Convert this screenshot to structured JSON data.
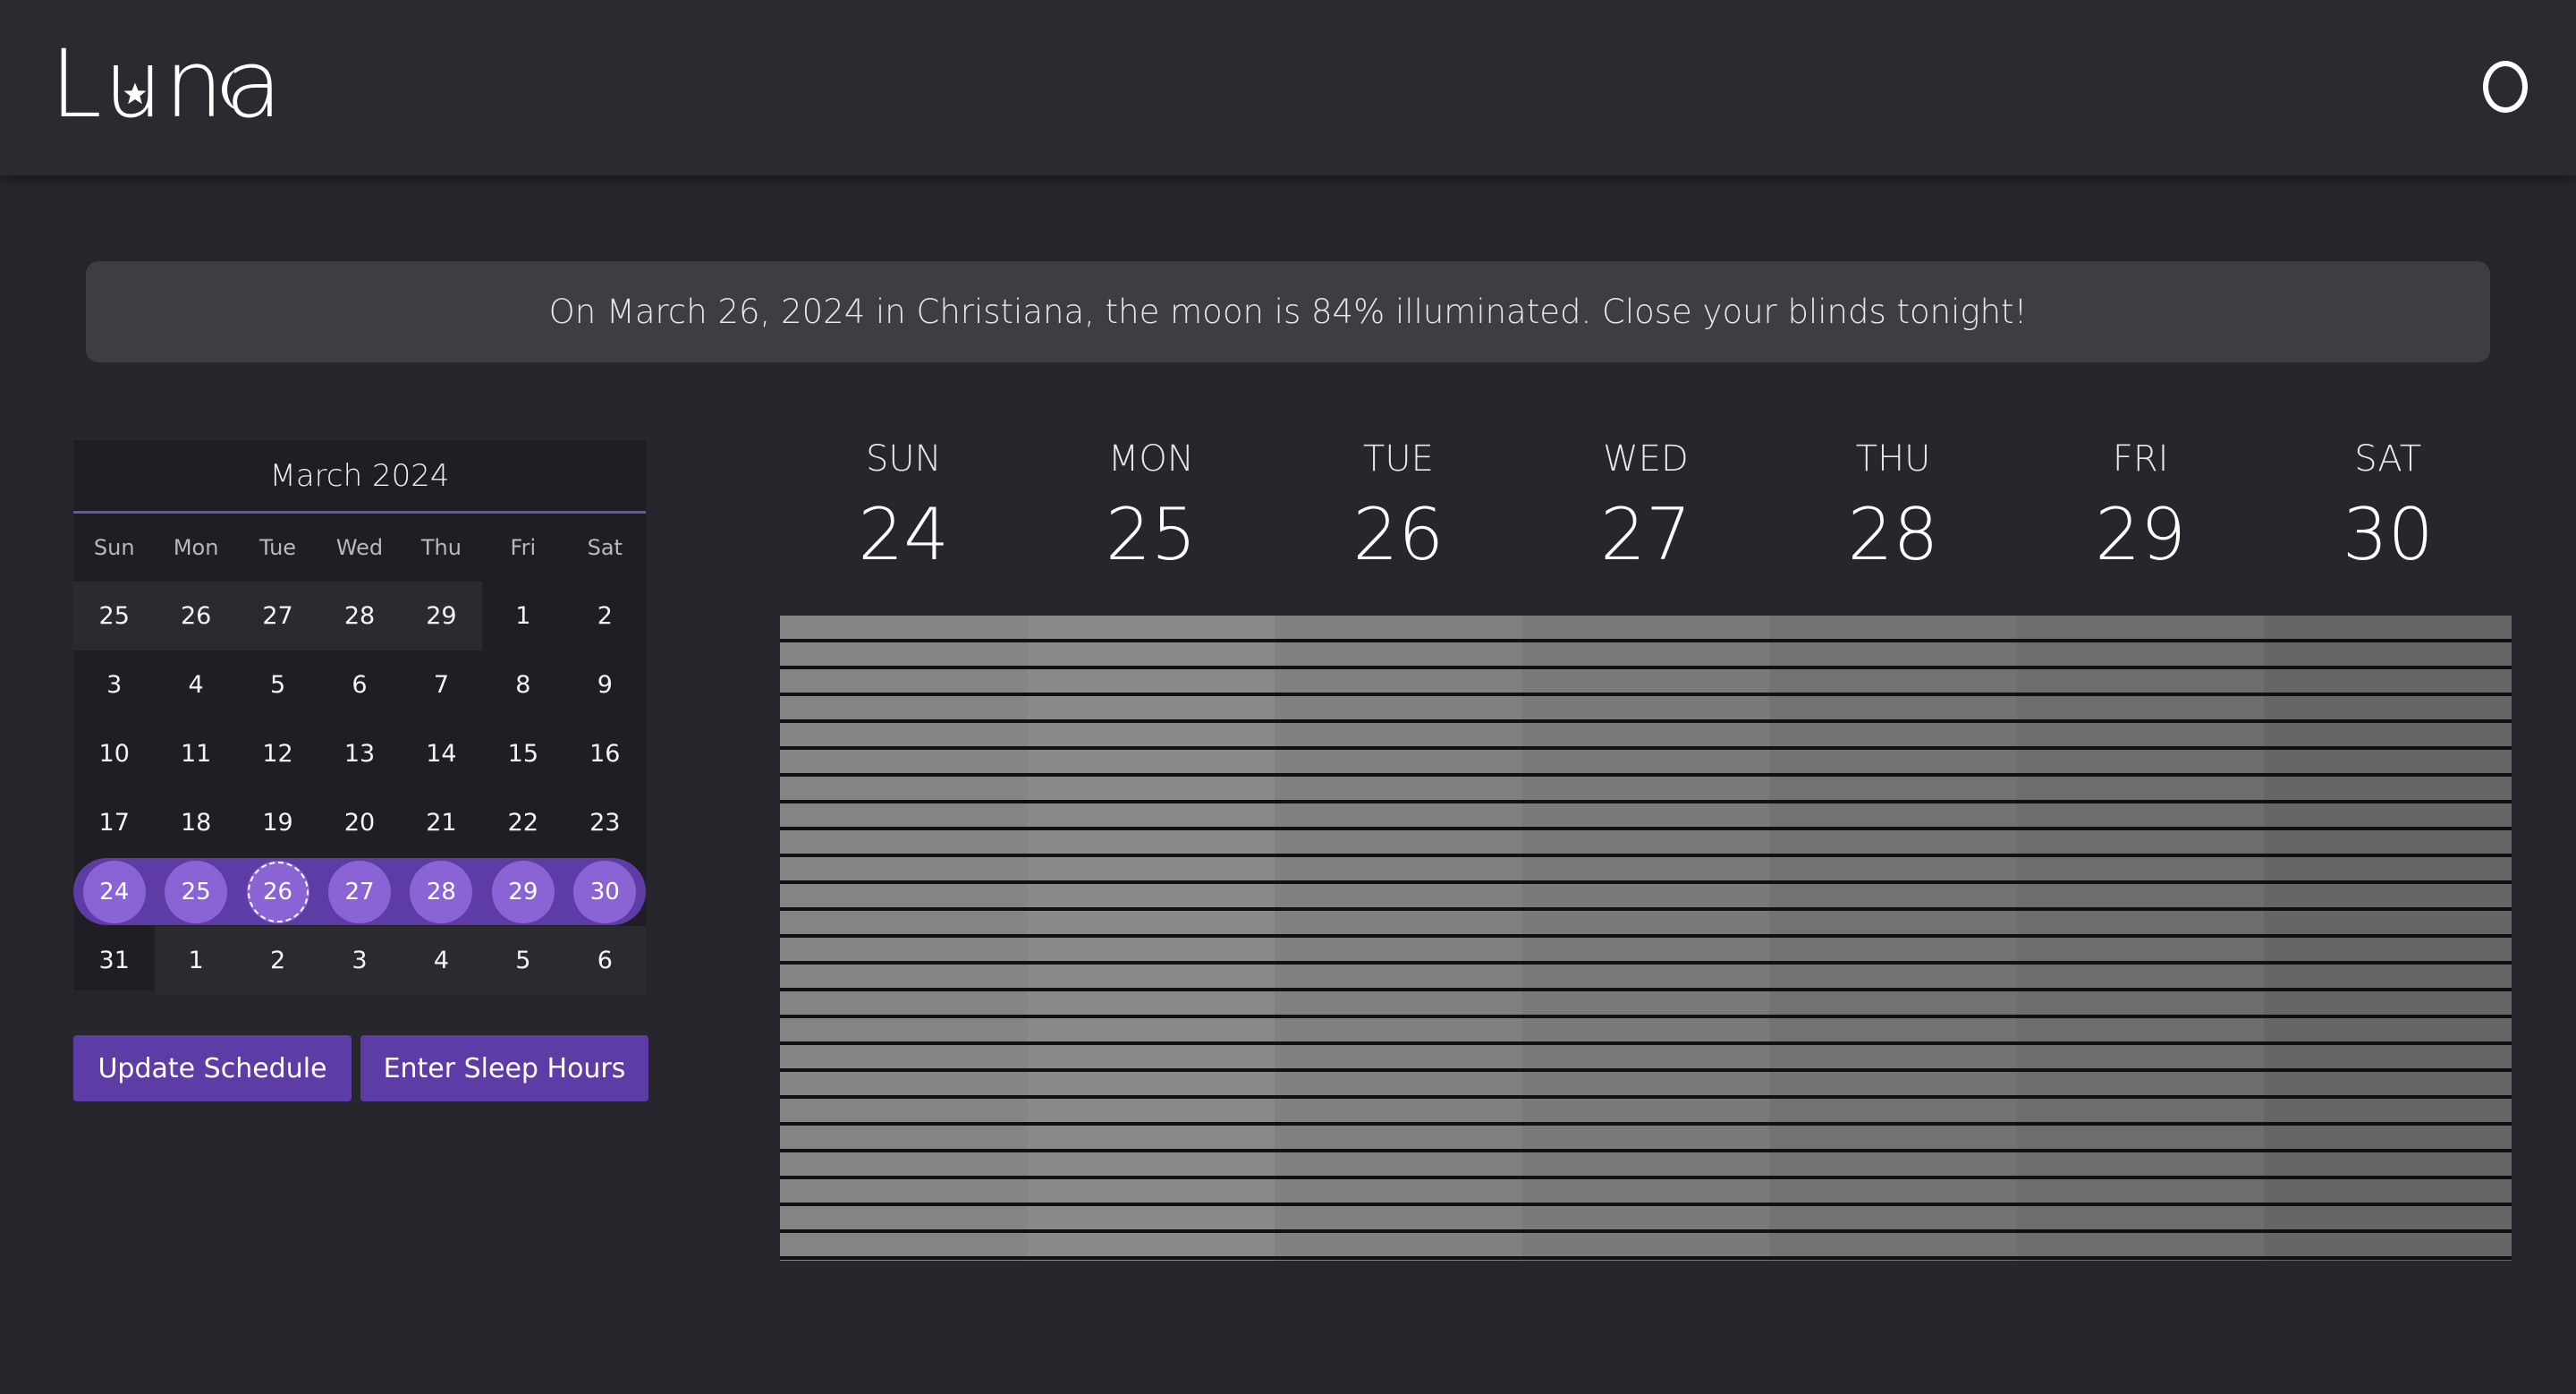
{
  "header": {
    "logo_text": "Luna",
    "icons": [
      "star-icon",
      "crescent-moon-icon",
      "moon-icon"
    ]
  },
  "banner": {
    "message": "On March 26, 2024 in Christiana, the moon is 84% illuminated. Close your blinds tonight!"
  },
  "calendar": {
    "title": "March 2024",
    "weekdays": [
      "Sun",
      "Mon",
      "Tue",
      "Wed",
      "Thu",
      "Fri",
      "Sat"
    ],
    "weeks": [
      [
        "25",
        "26",
        "27",
        "28",
        "29",
        "1",
        "2"
      ],
      [
        "3",
        "4",
        "5",
        "6",
        "7",
        "8",
        "9"
      ],
      [
        "10",
        "11",
        "12",
        "13",
        "14",
        "15",
        "16"
      ],
      [
        "17",
        "18",
        "19",
        "20",
        "21",
        "22",
        "23"
      ],
      [
        "24",
        "25",
        "26",
        "27",
        "28",
        "29",
        "30"
      ],
      [
        "31",
        "1",
        "2",
        "3",
        "4",
        "5",
        "6"
      ]
    ],
    "selected_week_index": 4,
    "today": "26",
    "accent_color": "#5e3ca6",
    "selected_day_color": "#8a64d4"
  },
  "buttons": {
    "update_schedule": "Update Schedule",
    "enter_sleep_hours": "Enter Sleep Hours"
  },
  "week_view": {
    "days": [
      {
        "name": "SUN",
        "date": "24",
        "shade": "#858585"
      },
      {
        "name": "MON",
        "date": "25",
        "shade": "#8a8a8a"
      },
      {
        "name": "TUE",
        "date": "26",
        "shade": "#808080"
      },
      {
        "name": "WED",
        "date": "27",
        "shade": "#7a7a7b"
      },
      {
        "name": "THU",
        "date": "28",
        "shade": "#737374"
      },
      {
        "name": "FRI",
        "date": "29",
        "shade": "#6d6d6e"
      },
      {
        "name": "SAT",
        "date": "30",
        "shade": "#666667"
      }
    ]
  }
}
